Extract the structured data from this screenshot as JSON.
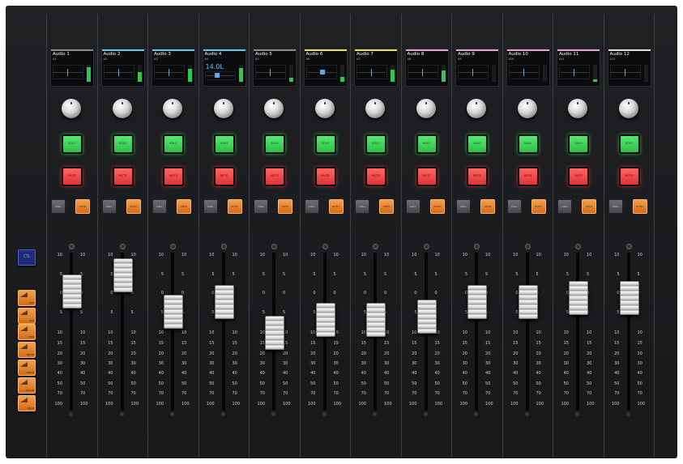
{
  "colors": {
    "panel": "#1b1c1e",
    "solo": "#3dd65c",
    "mute": "#ef4444",
    "auto": "#e8822d",
    "call": "#5a5c60",
    "meter_blue": "#5aa9ea",
    "vu_green": "#35c54a"
  },
  "left_buttons": [
    {
      "label": "CTL",
      "type": "ctl"
    },
    {
      "label": "R/W",
      "type": "orange"
    },
    {
      "label": "R/W",
      "type": "orange"
    },
    {
      "label": "TRIM",
      "type": "orange"
    },
    {
      "label": "WRITE",
      "type": "orange"
    },
    {
      "label": "LATCH",
      "type": "orange"
    },
    {
      "label": "TOUCH",
      "type": "orange"
    },
    {
      "label": "READ",
      "type": "orange"
    }
  ],
  "button_labels": {
    "solo": "SOLO",
    "mute": "MUTE",
    "call": "CALL",
    "auto": "AUTO"
  },
  "scale_left": [
    "10",
    "5",
    "0",
    "5",
    "10",
    "15",
    "20",
    "30",
    "40",
    "50",
    "70",
    "100"
  ],
  "scale_right": [
    "10",
    "5",
    "0",
    "5",
    "10",
    "15",
    "20",
    "30",
    "40",
    "50",
    "70",
    "100"
  ],
  "channels": [
    {
      "name": "Audio 1",
      "sub": "A1",
      "color": "#8c8c8c",
      "value_text": "",
      "pan_level": 0.5,
      "meter_level": 0.85,
      "fader_level": 0.76
    },
    {
      "name": "Audio 2",
      "sub": "A2",
      "color": "#5ec8e5",
      "value_text": "",
      "pan_level": 0.5,
      "meter_level": 0.55,
      "fader_level": 0.86
    },
    {
      "name": "Audio 3",
      "sub": "A3",
      "color": "#5ec8e5",
      "value_text": "",
      "pan_level": 0.5,
      "meter_level": 0.75,
      "fader_level": 0.63
    },
    {
      "name": "Audio 4",
      "sub": "A4",
      "color": "#5ec8e5",
      "value_text": "14.0L",
      "pan_level": 0.4,
      "meter_level": 0.8,
      "fader_level": 0.69
    },
    {
      "name": "Audio 5",
      "sub": "A5",
      "color": "#8c8c8c",
      "value_text": "",
      "pan_level": 0.5,
      "meter_level": 0.25,
      "fader_level": 0.5
    },
    {
      "name": "Audio 6",
      "sub": "A6",
      "color": "#f0e54a",
      "value_text": "",
      "pan_level": 0.55,
      "meter_level": 0.3,
      "fader_level": 0.58
    },
    {
      "name": "Audio 7",
      "sub": "A7",
      "color": "#f0e54a",
      "value_text": "",
      "pan_level": 0.5,
      "meter_level": 0.7,
      "fader_level": 0.58
    },
    {
      "name": "Audio 8",
      "sub": "A8",
      "color": "#e7a3d8",
      "value_text": "",
      "pan_level": 0.5,
      "meter_level": 0.65,
      "fader_level": 0.6
    },
    {
      "name": "Audio 9",
      "sub": "A9",
      "color": "#e7a3d8",
      "value_text": "",
      "pan_level": 0.5,
      "meter_level": 0.0,
      "fader_level": 0.69
    },
    {
      "name": "Audio 10",
      "sub": "A10",
      "color": "#e7a3d8",
      "value_text": "",
      "pan_level": 0.5,
      "meter_level": 0.0,
      "fader_level": 0.69
    },
    {
      "name": "Audio 11",
      "sub": "A11",
      "color": "#e7a3d8",
      "value_text": "",
      "pan_level": 0.5,
      "meter_level": 0.15,
      "fader_level": 0.72
    },
    {
      "name": "Audio 12",
      "sub": "A12",
      "color": "#e0e0e0",
      "value_text": "",
      "pan_level": 0.5,
      "meter_level": 0.0,
      "fader_level": 0.72
    }
  ]
}
